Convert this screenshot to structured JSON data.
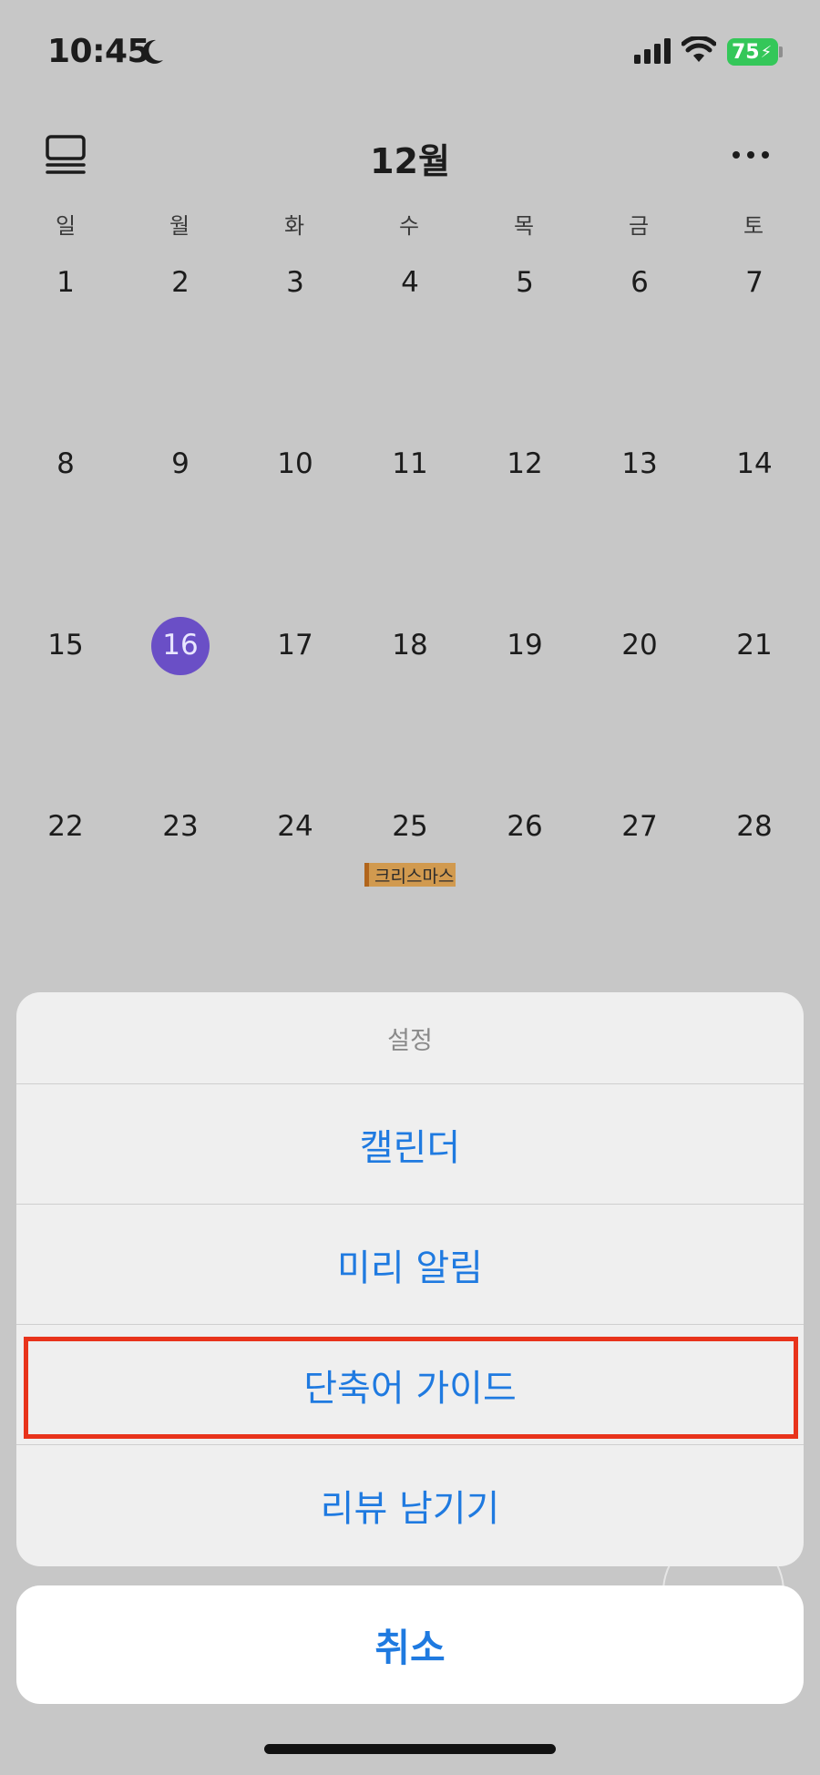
{
  "status_bar": {
    "time": "10:45",
    "battery": "75"
  },
  "header": {
    "month": "12월"
  },
  "weekdays": [
    "일",
    "월",
    "화",
    "수",
    "목",
    "금",
    "토"
  ],
  "weeks": [
    [
      "1",
      "2",
      "3",
      "4",
      "5",
      "6",
      "7"
    ],
    [
      "8",
      "9",
      "10",
      "11",
      "12",
      "13",
      "14"
    ],
    [
      "15",
      "16",
      "17",
      "18",
      "19",
      "20",
      "21"
    ],
    [
      "22",
      "23",
      "24",
      "25",
      "26",
      "27",
      "28"
    ]
  ],
  "today": "16",
  "event": {
    "label": "크리스마스",
    "color": "#d19a4f"
  },
  "action_sheet": {
    "title": "설정",
    "items": [
      "캘린더",
      "미리 알림",
      "단축어 가이드",
      "리뷰 남기기"
    ],
    "cancel": "취소"
  },
  "colors": {
    "accent": "#1f7ae0",
    "today": "#6a4fc6",
    "highlight": "#e8331b"
  }
}
